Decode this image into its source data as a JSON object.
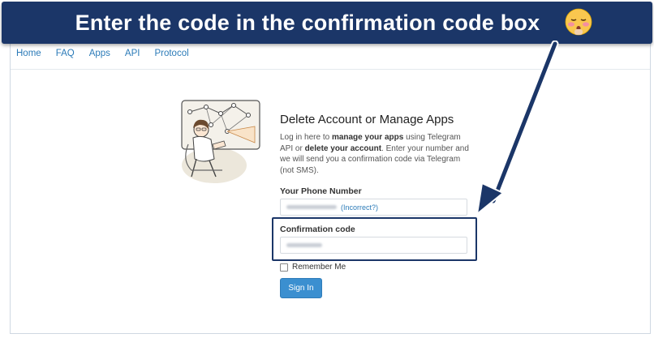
{
  "banner": {
    "text": "Enter the code in the confirmation code box"
  },
  "nav": {
    "items": [
      "Home",
      "FAQ",
      "Apps",
      "API",
      "Protocol"
    ]
  },
  "form": {
    "title": "Delete Account or Manage Apps",
    "intro_parts": [
      "Log in here to ",
      "manage your apps",
      " using Telegram API or ",
      "delete your account",
      ". Enter your number and we will send you a confirmation code via Telegram (not SMS)."
    ],
    "phone_label": "Your Phone Number",
    "phone_incorrect": "(Incorrect?)",
    "code_label": "Confirmation code",
    "remember_label": "Remember Me",
    "signin_label": "Sign In"
  },
  "colors": {
    "banner": "#1b3668",
    "link": "#2c7bb8",
    "button": "#3b8fd0"
  },
  "icons": {
    "emoji": "face-with-rosy-cheeks-emoji",
    "illustration": "telegram-developer-illustration"
  }
}
